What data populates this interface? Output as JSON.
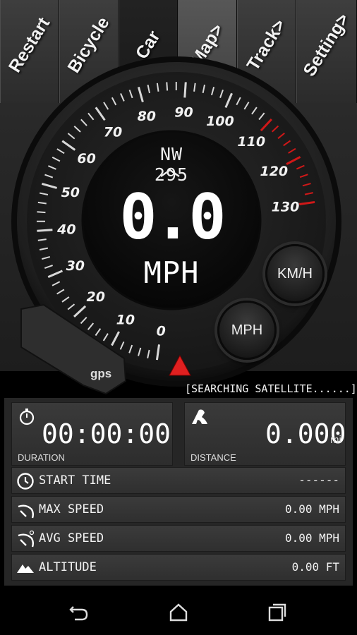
{
  "tabs": [
    {
      "label": "Restart"
    },
    {
      "label": "Bicycle"
    },
    {
      "label": "Car"
    },
    {
      "label": "Map>"
    },
    {
      "label": "Track>"
    },
    {
      "label": "Setting>"
    }
  ],
  "gauge": {
    "heading": "NW 295",
    "speed": "0.0",
    "unit": "MPH",
    "scale_labels": [
      "0",
      "10",
      "20",
      "30",
      "40",
      "50",
      "60",
      "70",
      "80",
      "90",
      "100",
      "110",
      "120",
      "130"
    ],
    "needle_color": "#e02020",
    "redline_color": "#d01818"
  },
  "unit_buttons": {
    "kmh": "KM/H",
    "mph": "MPH"
  },
  "gps": {
    "label": "gps",
    "status": "[SEARCHING SATELLITE......]"
  },
  "duration": {
    "value": "00:00:00",
    "label": "DURATION"
  },
  "distance": {
    "value": "0.000",
    "unit": "mi",
    "label": "DISTANCE"
  },
  "stats": {
    "start_time": {
      "label": "START TIME",
      "value": "------"
    },
    "max_speed": {
      "label": "MAX SPEED",
      "value": "0.00 MPH"
    },
    "avg_speed": {
      "label": "AVG SPEED",
      "value": "0.00 MPH"
    },
    "altitude": {
      "label": "ALTITUDE",
      "value": "0.00 FT"
    }
  },
  "icons": {
    "stopwatch": "stopwatch-icon",
    "road": "road-icon",
    "clock": "clock-icon",
    "max_speed": "speedometer-icon",
    "avg_speed": "speedometer-avg-icon",
    "altitude": "mountain-icon",
    "back": "back-icon",
    "home": "home-icon",
    "recents": "recents-icon"
  }
}
